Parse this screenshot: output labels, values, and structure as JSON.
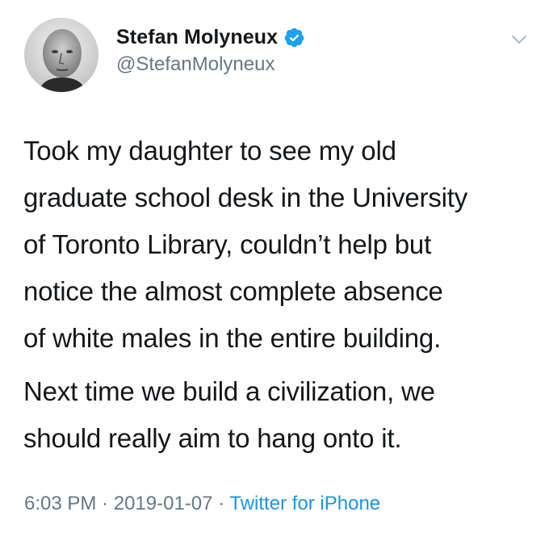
{
  "user": {
    "display_name": "Stefan Molyneux",
    "handle": "@StefanMolyneux",
    "verified": true
  },
  "tweet": {
    "paragraphs": [
      "Took my daughter to see my old\ngraduate school desk in the University\nof Toronto Library, couldn’t help but\nnotice the almost complete absence\nof white males in the entire building.",
      "Next time we build a civilization, we\nshould really aim to hang onto it."
    ]
  },
  "meta": {
    "time": "6:03 PM",
    "separator": " · ",
    "date": "2019-01-07",
    "source": "Twitter for iPhone"
  },
  "icons": {
    "verified": "verified-badge-icon",
    "caret": "chevron-down-icon"
  },
  "colors": {
    "text": "#14171a",
    "secondary": "#657786",
    "link": "#1b95e0",
    "verified": "#1da1f2"
  }
}
